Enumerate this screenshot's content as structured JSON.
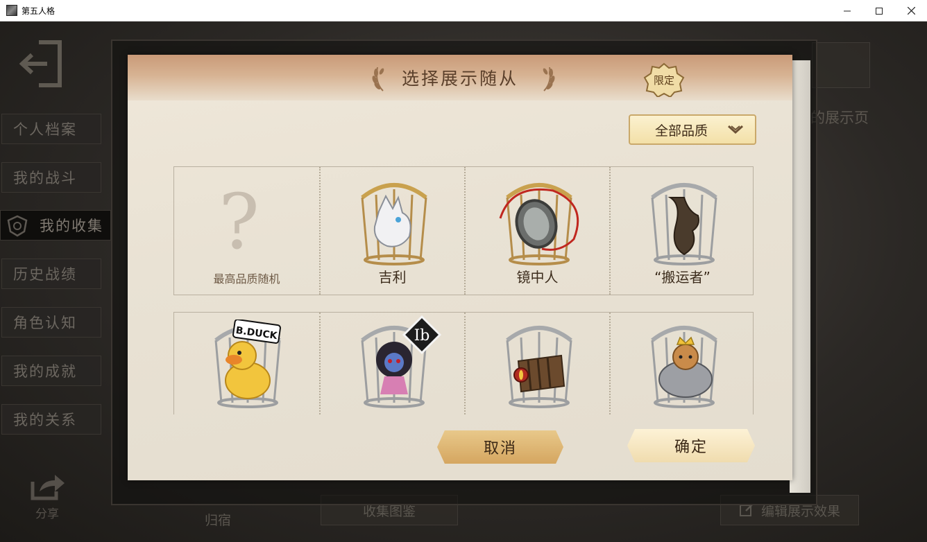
{
  "window": {
    "title": "第五人格",
    "minimize_icon": "minimize-icon",
    "maximize_icon": "maximize-icon",
    "close_icon": "close-icon"
  },
  "sidebar": {
    "items": [
      {
        "label": "个人档案",
        "active": false
      },
      {
        "label": "我的战斗",
        "active": false
      },
      {
        "label": "我的收集",
        "active": true
      },
      {
        "label": "历史战绩",
        "active": false
      },
      {
        "label": "角色认知",
        "active": false
      },
      {
        "label": "我的成就",
        "active": false
      },
      {
        "label": "我的关系",
        "active": false
      }
    ]
  },
  "background": {
    "right_text": "的展示页",
    "share_label": "分享",
    "dorm_label": "归宿",
    "catalog_label": "收集图鉴",
    "edit_display_label": "编辑展示效果"
  },
  "modal": {
    "title": "选择展示随从",
    "quality_filter": "全部品质",
    "pets_row1": [
      {
        "label": "最高品质随机",
        "icon": "question-mark-icon"
      },
      {
        "label": "吉利",
        "icon": "white-wolf-pet"
      },
      {
        "label": "镜中人",
        "icon": "mirror-pet"
      },
      {
        "label": "“搬运者”",
        "icon": "carrier-pet",
        "badge": "限定"
      }
    ],
    "pets_row2": [
      {
        "label": "",
        "icon": "bduck-pet",
        "badge": "B.DUCK"
      },
      {
        "label": "",
        "icon": "ib-doll-pet",
        "badge": "Ib"
      },
      {
        "label": "",
        "icon": "accordion-pet"
      },
      {
        "label": "",
        "icon": "crowned-cat-pet"
      }
    ],
    "cancel_label": "取消",
    "confirm_label": "确定"
  },
  "colors": {
    "modal_paper": "#ebe4d6",
    "header_tint": "#d2a683",
    "button_gold": "#e0b877",
    "text_dark": "#3d2d1d"
  }
}
